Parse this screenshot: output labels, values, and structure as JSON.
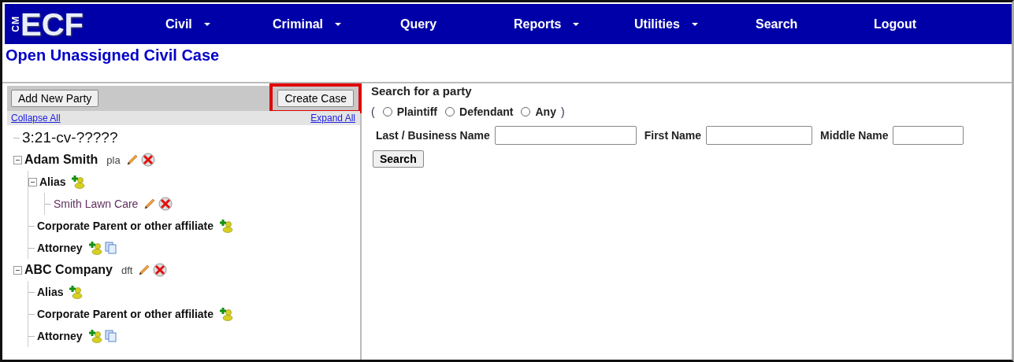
{
  "logo": {
    "small": "CM",
    "big": "ECF"
  },
  "nav": [
    {
      "label": "Civil",
      "dropdown": true
    },
    {
      "label": "Criminal",
      "dropdown": true
    },
    {
      "label": "Query",
      "dropdown": false
    },
    {
      "label": "Reports",
      "dropdown": true
    },
    {
      "label": "Utilities",
      "dropdown": true
    },
    {
      "label": "Search",
      "dropdown": false
    },
    {
      "label": "Logout",
      "dropdown": false
    }
  ],
  "page_title": "Open Unassigned Civil Case",
  "left_panel": {
    "add_button": "Add New Party",
    "create_button": {
      "label": "Create Case",
      "highlighted": true
    },
    "collapse_link": "Collapse All",
    "expand_link": "Expand All",
    "tree": [
      {
        "kind": "case",
        "label": "3:21-cv-?????"
      },
      {
        "kind": "party",
        "label": "Adam Smith",
        "role": "pla",
        "expanded": true,
        "children": [
          {
            "kind": "alias-group",
            "label": "Alias",
            "expanded": true,
            "children": [
              {
                "kind": "alias",
                "label": "Smith Lawn Care"
              }
            ]
          },
          {
            "kind": "affiliate-group",
            "label": "Corporate Parent or other affiliate"
          },
          {
            "kind": "attorney-group",
            "label": "Attorney"
          }
        ]
      },
      {
        "kind": "party",
        "label": "ABC Company",
        "role": "dft",
        "expanded": true,
        "children": [
          {
            "kind": "alias-group",
            "label": "Alias"
          },
          {
            "kind": "affiliate-group",
            "label": "Corporate Parent or other affiliate"
          },
          {
            "kind": "attorney-group",
            "label": "Attorney"
          }
        ]
      }
    ]
  },
  "search_panel": {
    "heading": "Search for a party",
    "open_paren": "(",
    "close_paren": ")",
    "roles": [
      {
        "label": "Plaintiff",
        "selected": false
      },
      {
        "label": "Defendant",
        "selected": false
      },
      {
        "label": "Any",
        "selected": false
      }
    ],
    "fields": [
      {
        "label": "Last / Business Name"
      },
      {
        "label": "First Name"
      },
      {
        "label": "Middle Name"
      }
    ],
    "button": "Search"
  }
}
